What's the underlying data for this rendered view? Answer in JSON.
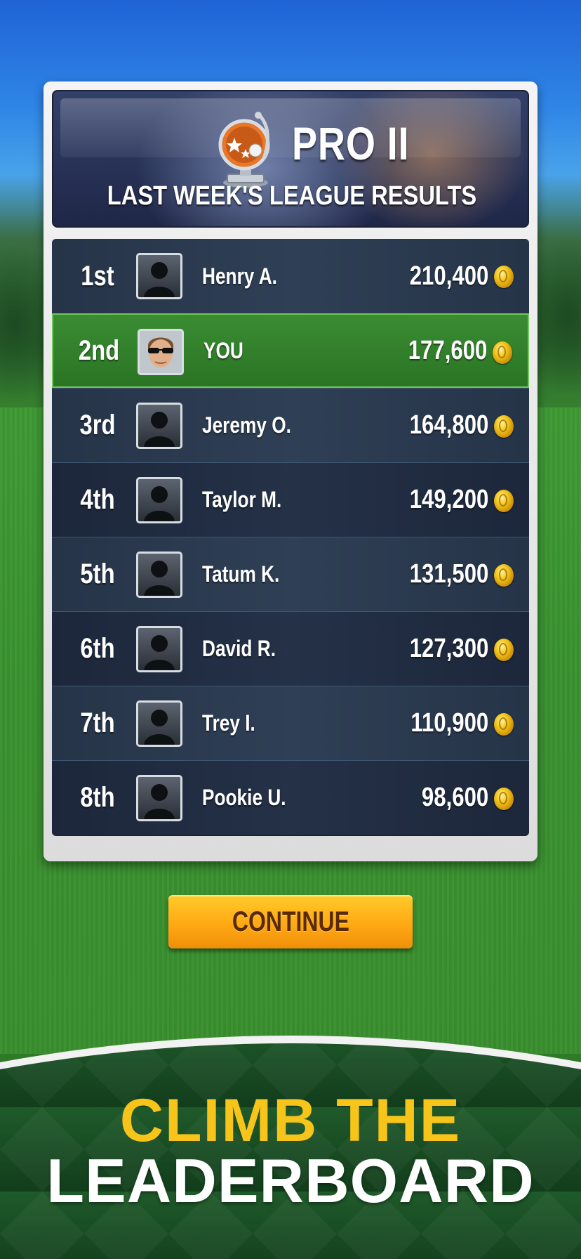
{
  "header": {
    "league_name": "PRO II",
    "subtitle": "LAST WEEK'S LEAGUE RESULTS"
  },
  "leaderboard": {
    "rows": [
      {
        "rank": "1st",
        "name": "Henry A.",
        "score": "210,400",
        "is_you": false
      },
      {
        "rank": "2nd",
        "name": "YOU",
        "score": "177,600",
        "is_you": true
      },
      {
        "rank": "3rd",
        "name": "Jeremy O.",
        "score": "164,800",
        "is_you": false
      },
      {
        "rank": "4th",
        "name": "Taylor M.",
        "score": "149,200",
        "is_you": false
      },
      {
        "rank": "5th",
        "name": "Tatum K.",
        "score": "131,500",
        "is_you": false
      },
      {
        "rank": "6th",
        "name": "David R.",
        "score": "127,300",
        "is_you": false
      },
      {
        "rank": "7th",
        "name": "Trey I.",
        "score": "110,900",
        "is_you": false
      },
      {
        "rank": "8th",
        "name": "Pookie U.",
        "score": "98,600",
        "is_you": false
      }
    ]
  },
  "actions": {
    "continue_label": "CONTINUE"
  },
  "promo": {
    "line1": "CLIMB THE",
    "line2": "LEADERBOARD"
  },
  "icons": {
    "trophy": "trophy-icon",
    "coin": "coin-icon",
    "avatar_placeholder": "silhouette-avatar-icon"
  },
  "colors": {
    "you_row": "#2f7f2a",
    "continue_button": "#ffb018",
    "promo_highlight": "#f7c41a"
  }
}
